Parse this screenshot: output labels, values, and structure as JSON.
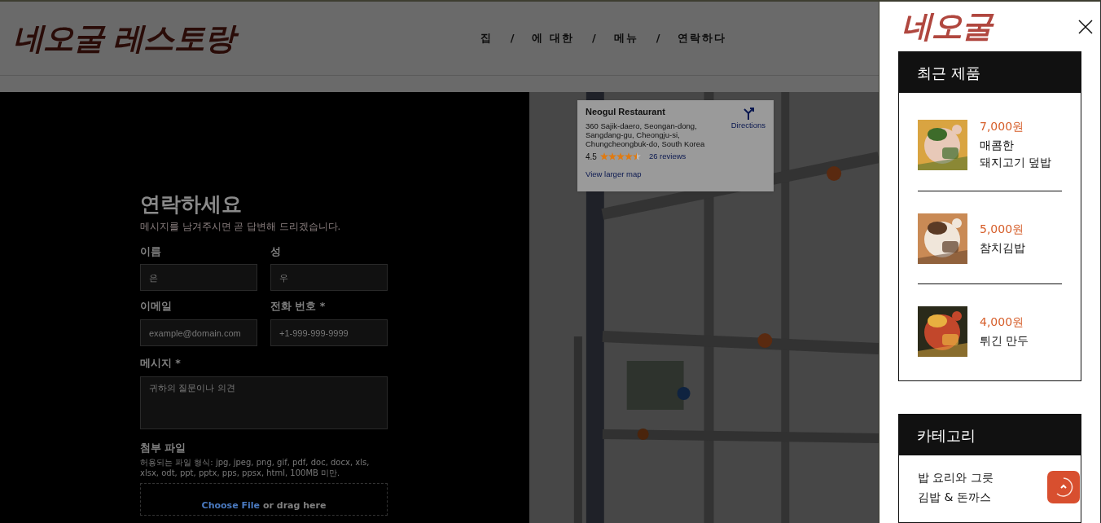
{
  "header": {
    "logo": "네오굴 레스토랑",
    "nav": [
      {
        "kind": "link",
        "label": "집"
      },
      {
        "kind": "separator",
        "label": "/"
      },
      {
        "kind": "link",
        "label": "에 대한"
      },
      {
        "kind": "separator",
        "label": "/"
      },
      {
        "kind": "link",
        "label": "메뉴"
      },
      {
        "kind": "separator",
        "label": "/"
      },
      {
        "kind": "link",
        "label": "연락하다"
      }
    ]
  },
  "contact_form": {
    "title": "연락하세요",
    "subtitle": "메시지를 남겨주시면 곧 답변해 드리겠습니다.",
    "fields": [
      {
        "label": "이름",
        "placeholder": "은"
      },
      {
        "label": "성",
        "placeholder": "우"
      },
      {
        "label": "이메일",
        "placeholder": "example@domain.com"
      },
      {
        "label": "전화 번호 *",
        "placeholder": "+1-999-999-9999"
      }
    ],
    "message": {
      "label": "메시지 *",
      "placeholder": "귀하의 질문이나 의견"
    },
    "attachment": {
      "label": "첨부 파일",
      "hint": "허용되는 파일 형식: jpg, jpeg, png, gif, pdf, doc, docx, xls, xlsx, odt, ppt, pptx, pps, ppsx, html, 100MB 미만.",
      "choose": "Choose File",
      "drag": "or drag here"
    }
  },
  "map_card": {
    "title": "Neogul Restaurant",
    "address": "360 Sajik-daero, Seongan-dong, Sangdang-gu, Cheongju-si, Chungcheongbuk-do, South Korea",
    "rating": "4.5",
    "stars": 4.5,
    "reviews": "26 reviews",
    "directions": "Directions",
    "larger_map": "View larger map"
  },
  "sidebar": {
    "logo": "네오굴",
    "recent_products": {
      "title": "최근 제품",
      "items": [
        {
          "price": "7,000원",
          "name": "매콤한 돼지고기 덮밥"
        },
        {
          "price": "5,000원",
          "name": "참치김밥"
        },
        {
          "price": "4,000원",
          "name": "튀긴 만두"
        }
      ]
    },
    "categories": {
      "title": "카테고리",
      "items": [
        "밥 요리와 그릇",
        "김밥 & 돈까스"
      ]
    }
  }
}
